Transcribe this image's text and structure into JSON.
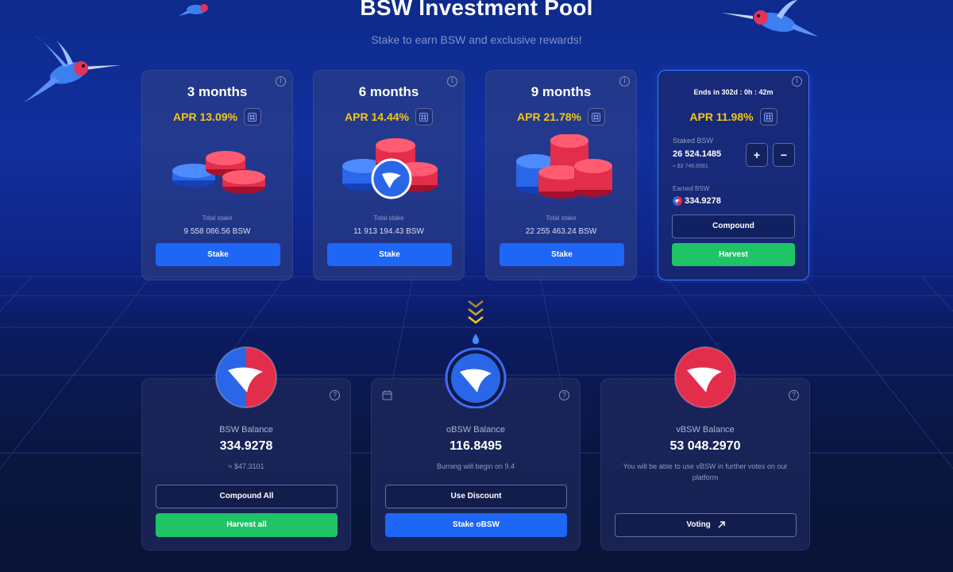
{
  "header": {
    "title": "BSW Investment Pool",
    "subtitle": "Stake to earn BSW and exclusive rewards!"
  },
  "pools": [
    {
      "period": "3 months",
      "apr": "APR 13.09%",
      "total_stake_label": "Total stake",
      "total_stake": "9 558 086.56 BSW",
      "button": "Stake"
    },
    {
      "period": "6 months",
      "apr": "APR 14.44%",
      "total_stake_label": "Total stake",
      "total_stake": "11 913 194.43 BSW",
      "button": "Stake"
    },
    {
      "period": "9 months",
      "apr": "APR 21.78%",
      "total_stake_label": "Total stake",
      "total_stake": "22 255 463.24 BSW",
      "button": "Stake"
    }
  ],
  "active_pool": {
    "ends": "Ends in 302d : 0h : 42m",
    "apr": "APR 11.98%",
    "staked_label": "Staked BSW",
    "staked_value": "26 524.1485",
    "staked_usd": "≈ $3 746.6581",
    "plus": "+",
    "minus": "−",
    "earned_label": "Earned BSW",
    "earned_value": "334.9278",
    "compound_button": "Compound",
    "harvest_button": "Harvest"
  },
  "balances": {
    "bsw": {
      "label": "BSW Balance",
      "value": "334.9278",
      "usd": "≈ $47.3101",
      "compound_all": "Compound All",
      "harvest_all": "Harvest all"
    },
    "obsw": {
      "label": "oBSW Balance",
      "value": "116.8495",
      "note": "Burning will begin on 9.4",
      "use_discount": "Use Discount",
      "stake_obsw": "Stake oBSW"
    },
    "vbsw": {
      "label": "vBSW Balance",
      "value": "53 048.2970",
      "note": "You will be able to use vBSW in further votes on our platform",
      "voting": "Voting"
    }
  },
  "icons": {
    "info": "info-icon",
    "calculator": "calculator-icon",
    "help": "question-icon",
    "calendar": "calendar-icon",
    "external": "arrow-up-right-icon"
  },
  "colors": {
    "accent_blue": "#1e66f5",
    "accent_green": "#1fc466",
    "apr_yellow": "#f5c518",
    "active_border": "#3e79ff"
  }
}
